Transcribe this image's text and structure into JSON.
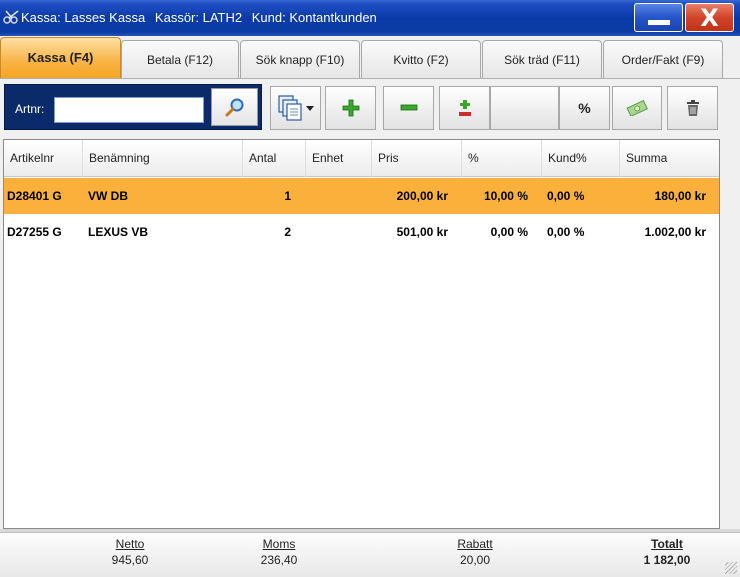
{
  "window": {
    "title_parts": [
      "Kassa: Lasses Kassa",
      "Kassör: LATH2",
      "Kund: Kontantkunden"
    ],
    "minimize_icon": "minimize-icon",
    "close_label": "X"
  },
  "tabs": [
    {
      "label": "Kassa (F4)",
      "active": true
    },
    {
      "label": "Betala (F12)",
      "active": false
    },
    {
      "label": "Sök knapp (F10)",
      "active": false
    },
    {
      "label": "Kvitto (F2)",
      "active": false
    },
    {
      "label": "Sök träd (F11)",
      "active": false
    },
    {
      "label": "Order/Fakt (F9)",
      "active": false
    }
  ],
  "toolbar": {
    "artnr_label": "Artnr:",
    "artnr_value": "",
    "artnr_placeholder": "",
    "search_icon": "search-icon",
    "copy_icon": "copy-dropdown-icon",
    "add_icon": "plus-icon",
    "remove_icon": "minus-icon",
    "plusminus_icon": "plus-minus-icon",
    "percent_label": "%",
    "discount_icon": "money-icon",
    "delete_icon": "trash-icon"
  },
  "grid": {
    "columns": [
      "Artikelnr",
      "Benämning",
      "Antal",
      "Enhet",
      "Pris",
      "%",
      "Kund%",
      "Summa"
    ],
    "rows": [
      {
        "artikelnr": "D28401 G",
        "benamning": "VW DB",
        "antal": "1",
        "enhet": "",
        "pris": "200,00 kr",
        "procent": "10,00 %",
        "kundprocent": "0,00 %",
        "summa": "180,00 kr",
        "selected": true
      },
      {
        "artikelnr": "D27255 G",
        "benamning": "LEXUS VB",
        "antal": "2",
        "enhet": "",
        "pris": "501,00 kr",
        "procent": "0,00 %",
        "kundprocent": "0,00 %",
        "summa": "1.002,00 kr",
        "selected": false
      }
    ]
  },
  "footer": {
    "netto": {
      "label": "Netto",
      "value": "945,60"
    },
    "moms": {
      "label": "Moms",
      "value": "236,40"
    },
    "rabatt": {
      "label": "Rabatt",
      "value": "20,00"
    },
    "totalt": {
      "label": "Totalt",
      "value": "1 182,00"
    }
  },
  "colors": {
    "titlebar": "#0a3aa8",
    "active_tab": "#f5a623",
    "selected_row": "#fbb03b",
    "search_panel": "#0a2a6a"
  }
}
